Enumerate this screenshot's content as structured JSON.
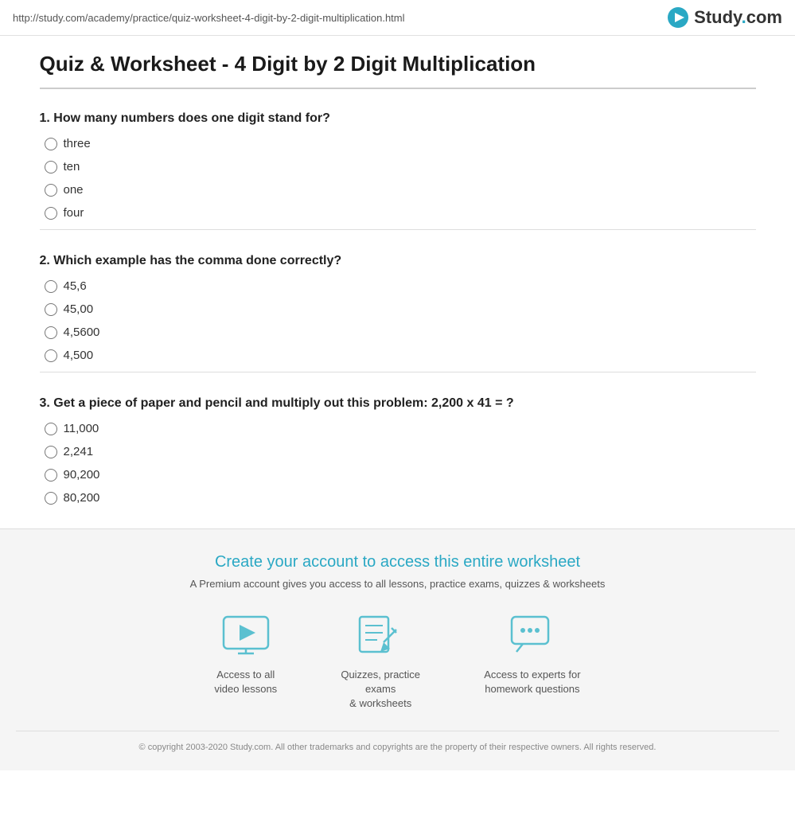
{
  "topbar": {
    "url": "http://study.com/academy/practice/quiz-worksheet-4-digit-by-2-digit-multiplication.html",
    "logo_text": "Study",
    "logo_dot": ".",
    "logo_com": "com"
  },
  "page": {
    "title": "Quiz & Worksheet - 4 Digit by 2 Digit Multiplication"
  },
  "questions": [
    {
      "id": "q1",
      "number": "1.",
      "text": "How many numbers does one digit stand for?",
      "options": [
        {
          "id": "q1a",
          "label": "three"
        },
        {
          "id": "q1b",
          "label": "ten"
        },
        {
          "id": "q1c",
          "label": "one"
        },
        {
          "id": "q1d",
          "label": "four"
        }
      ]
    },
    {
      "id": "q2",
      "number": "2.",
      "text": "Which example has the comma done correctly?",
      "options": [
        {
          "id": "q2a",
          "label": "45,6"
        },
        {
          "id": "q2b",
          "label": "45,00"
        },
        {
          "id": "q2c",
          "label": "4,5600"
        },
        {
          "id": "q2d",
          "label": "4,500"
        }
      ]
    },
    {
      "id": "q3",
      "number": "3.",
      "text": "Get a piece of paper and pencil and multiply out this problem: 2,200 x 41 = ?",
      "options": [
        {
          "id": "q3a",
          "label": "11,000"
        },
        {
          "id": "q3b",
          "label": "2,241"
        },
        {
          "id": "q3c",
          "label": "90,200"
        },
        {
          "id": "q3d",
          "label": "80,200"
        }
      ]
    }
  ],
  "footer": {
    "cta_title": "Create your account to access this entire worksheet",
    "cta_sub": "A Premium account gives you access to all lessons, practice exams, quizzes & worksheets",
    "features": [
      {
        "id": "feat1",
        "icon": "video",
        "label_line1": "Access to all",
        "label_line2": "video lessons"
      },
      {
        "id": "feat2",
        "icon": "quiz",
        "label_line1": "Quizzes, practice exams",
        "label_line2": "& worksheets"
      },
      {
        "id": "feat3",
        "icon": "expert",
        "label_line1": "Access to experts for",
        "label_line2": "homework questions"
      }
    ],
    "copyright": "© copyright 2003-2020 Study.com. All other trademarks and copyrights are the property of their respective owners. All rights reserved."
  }
}
